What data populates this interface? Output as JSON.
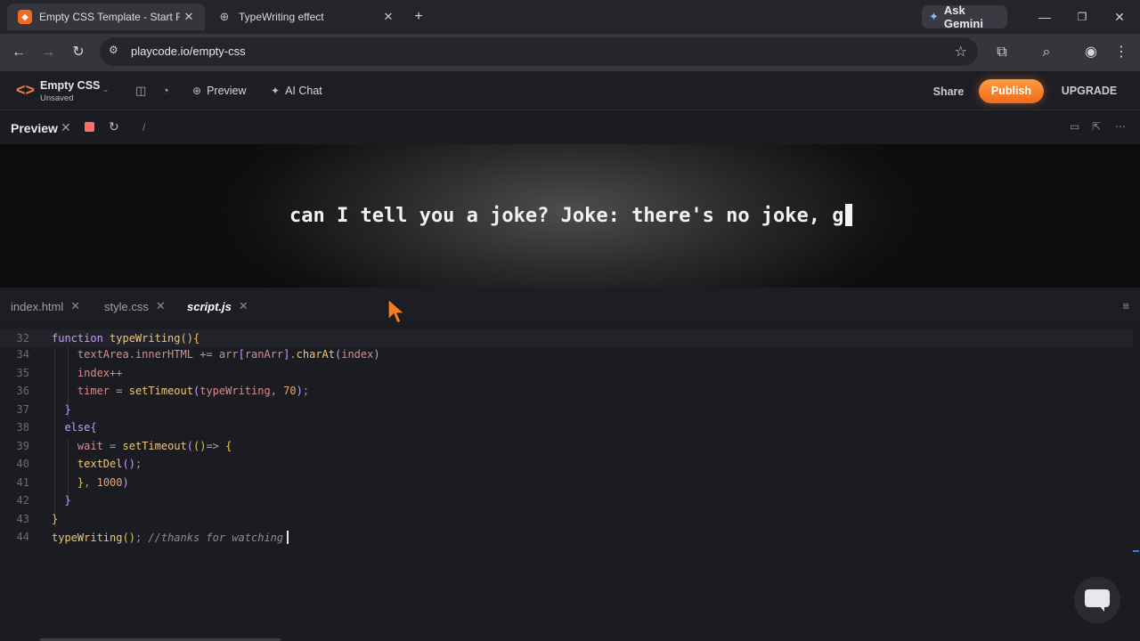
{
  "browser": {
    "tabs": [
      {
        "title": "Empty CSS Template - Start Fre",
        "active": true
      },
      {
        "title": "TypeWriting effect",
        "active": false
      }
    ],
    "new_tab_label": "+",
    "ask_gemini_label": "Ask Gemini",
    "url": "playcode.io/empty-css"
  },
  "app": {
    "project_name": "Empty CSS",
    "project_status": "Unsaved",
    "preview_label": "Preview",
    "ai_chat_label": "AI Chat",
    "share_label": "Share",
    "publish_label": "Publish",
    "upgrade_label": "UPGRADE"
  },
  "preview_pane": {
    "label": "Preview",
    "path": "/",
    "output_text": "can I tell you a joke? Joke: there's no joke, g"
  },
  "editor": {
    "tabs": [
      {
        "label": "index.html",
        "active": false
      },
      {
        "label": "style.css",
        "active": false
      },
      {
        "label": "script.js",
        "active": true
      }
    ],
    "line_numbers": [
      "32",
      "34",
      "35",
      "36",
      "37",
      "38",
      "39",
      "40",
      "41",
      "42",
      "43",
      "44"
    ]
  },
  "colors": {
    "accent_orange": "#f26b1d",
    "stop_red": "#ff6b6b",
    "keyword_purple": "#c79cff",
    "function_yellow": "#f0c674"
  }
}
